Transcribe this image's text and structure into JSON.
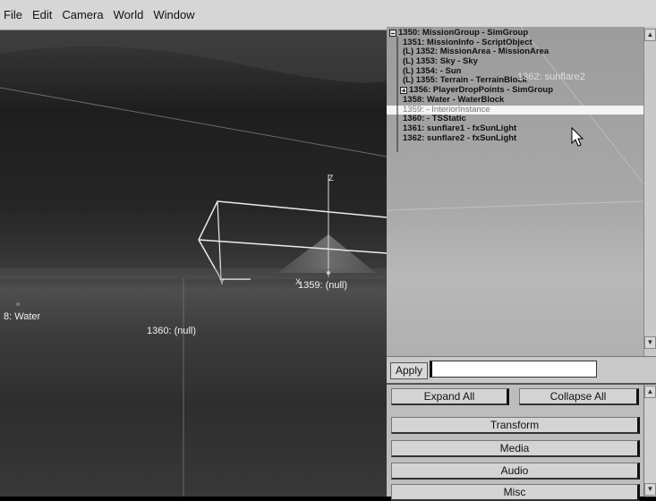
{
  "menu": [
    "File",
    "Edit",
    "Camera",
    "World",
    "Window"
  ],
  "viewport": {
    "labels": {
      "water": "8: Water",
      "null_1359": "1359: (null)",
      "null_1360": "1360: (null)"
    },
    "axis": {
      "z": "Z",
      "y": "Y",
      "x": "X"
    }
  },
  "tree": {
    "rows": [
      "1350: MissionGroup - SimGroup",
      "1351: MissionInfo - ScriptObject",
      "(L) 1352: MissionArea - MissionArea",
      "(L) 1353: Sky - Sky",
      "(L) 1354:  - Sun",
      "(L) 1355: Terrain - TerrainBlock",
      "1356: PlayerDropPoints - SimGroup",
      "1358: Water - WaterBlock",
      "1359:  - InteriorInstance",
      "1360:  - TSStatic",
      "1361: sunflare1 - fxSunLight",
      "1362: sunflare2 - fxSunLight"
    ],
    "ghost_label": "1362: sunflare2"
  },
  "apply": {
    "label": "Apply",
    "value": ""
  },
  "buttons": {
    "expand_all": "Expand All",
    "collapse_all": "Collapse All",
    "transform": "Transform",
    "media": "Media",
    "audio": "Audio",
    "misc": "Misc"
  }
}
